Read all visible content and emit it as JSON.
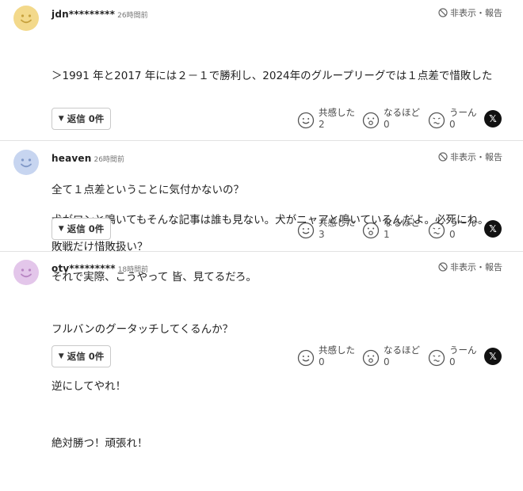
{
  "colors": {
    "avatar_yellow": "#f3d98b",
    "avatar_blue": "#c7d5f0",
    "avatar_purple": "#e3c6ea",
    "x_button": "#111111"
  },
  "icons": {
    "report": "no-entry-circle-icon",
    "reply_toggle": "triangle-down-icon",
    "share_x": "x-logo-icon"
  },
  "comments": [
    {
      "user": "jdn*********",
      "time": "26時間前",
      "report_label": "非表示・報告",
      "lines": [
        "＞1991 年と2017 年には２－１で勝利し、2024年のグループリーグでは１点差で惜敗した",
        "",
        "全て１点差ということに気付かないの？",
        "敗戦だけ惜敗扱い？"
      ],
      "reply_label": "返信 0件",
      "reactions": [
        {
          "label": "共感した",
          "count": "2"
        },
        {
          "label": "なるほど",
          "count": "0"
        },
        {
          "label": "うーん",
          "count": "0"
        }
      ],
      "x_label": "𝕏"
    },
    {
      "user": "heaven",
      "time": "26時間前",
      "report_label": "非表示・報告",
      "lines": [
        "犬がワンと鳴いてもそんな記事は誰も見ない。犬がニャアと鳴いているんだよ。必死にね。",
        "それで実際、こうやって 皆、見てるだろ。"
      ],
      "reply_label": "返信 0件",
      "reactions": [
        {
          "label": "共感した",
          "count": "3"
        },
        {
          "label": "なるほど",
          "count": "1"
        },
        {
          "label": "うーん",
          "count": "0"
        }
      ],
      "x_label": "𝕏"
    },
    {
      "user": "otv*********",
      "time": "18時間前",
      "report_label": "非表示・報告",
      "lines": [
        "フルバンのグータッチしてくるんか？",
        "逆にしてやれ！",
        "絶対勝つ！頑張れ！"
      ],
      "reply_label": "返信 0件",
      "reactions": [
        {
          "label": "共感した",
          "count": "0"
        },
        {
          "label": "なるほど",
          "count": "0"
        },
        {
          "label": "うーん",
          "count": "0"
        }
      ],
      "x_label": "𝕏"
    }
  ]
}
